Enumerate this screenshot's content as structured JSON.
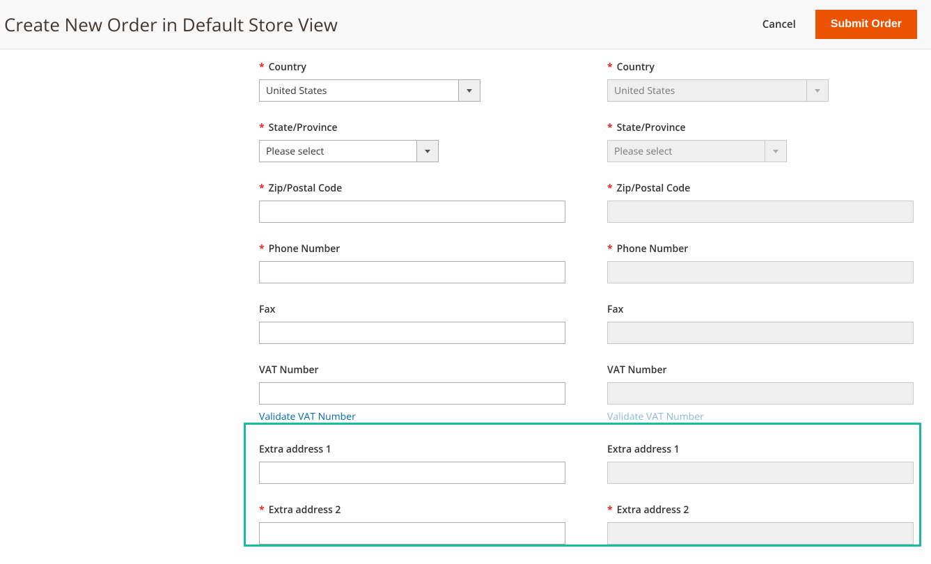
{
  "header": {
    "title": "Create New Order in Default Store View",
    "cancel": "Cancel",
    "submit": "Submit Order"
  },
  "labels": {
    "country": "Country",
    "state": "State/Province",
    "zip": "Zip/Postal Code",
    "phone": "Phone Number",
    "fax": "Fax",
    "vat": "VAT Number",
    "validate_vat": "Validate VAT Number",
    "extra1": "Extra address 1",
    "extra2": "Extra address 2"
  },
  "values": {
    "country": "United States",
    "state_placeholder": "Please select"
  }
}
